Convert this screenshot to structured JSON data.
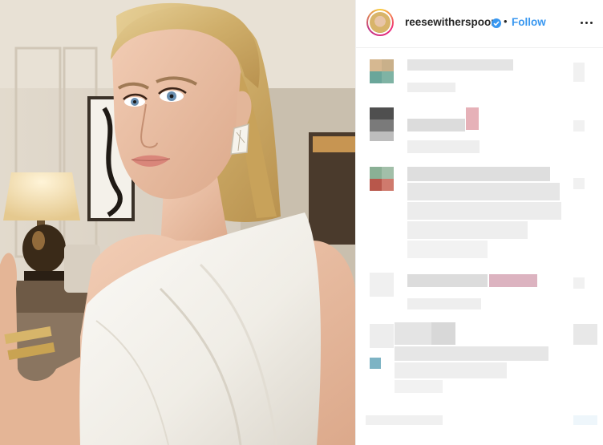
{
  "post": {
    "username": "reesewitherspoon",
    "separator": "•",
    "follow_label": "Follow",
    "verified_icon": "verified-badge-icon",
    "more_icon": "more-options-icon"
  },
  "colors": {
    "follow": "#3897f0",
    "text": "#262626",
    "border": "#efefef"
  }
}
